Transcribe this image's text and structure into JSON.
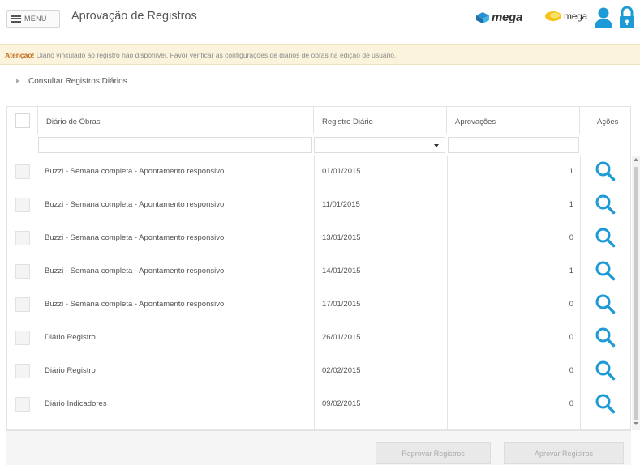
{
  "header": {
    "menu_label": "MENU",
    "title": "Aprovação de Registros",
    "brand1": "mega",
    "brand2": "mega"
  },
  "alert": {
    "strong": "Atenção!",
    "text": " Diário vinculado ao registro não disponível. Favor verificar as configurações de diários de obras na edição de usuário."
  },
  "consult": {
    "label": "Consultar Registros Diários"
  },
  "grid": {
    "columns": [
      "Diário de Obras",
      "Registro Diário",
      "Aprovações",
      "Ações"
    ],
    "rows": [
      {
        "name": "Buzzi - Semana completa - Apontamento responsivo",
        "date": "01/01/2015",
        "approvals": "1"
      },
      {
        "name": "Buzzi - Semana completa - Apontamento responsivo",
        "date": "11/01/2015",
        "approvals": "1"
      },
      {
        "name": "Buzzi - Semana completa - Apontamento responsivo",
        "date": "13/01/2015",
        "approvals": "0"
      },
      {
        "name": "Buzzi - Semana completa - Apontamento responsivo",
        "date": "14/01/2015",
        "approvals": "1"
      },
      {
        "name": "Buzzi - Semana completa - Apontamento responsivo",
        "date": "17/01/2015",
        "approvals": "0"
      },
      {
        "name": "Diário Registro",
        "date": "26/01/2015",
        "approvals": "0"
      },
      {
        "name": "Diário Registro",
        "date": "02/02/2015",
        "approvals": "0"
      },
      {
        "name": "Diário Indicadores",
        "date": "09/02/2015",
        "approvals": "0"
      }
    ]
  },
  "footer": {
    "reprove_label": "Reprovar Registros",
    "approve_label": "Aprovar Registros"
  },
  "colors": {
    "accent": "#1e9ad6",
    "alert_bg": "#fbf3dc",
    "alert_strong": "#c06a1a"
  },
  "icons": {
    "menu": "hamburger-icon",
    "user": "user-icon",
    "lock": "lock-icon",
    "action": "search-icon"
  }
}
